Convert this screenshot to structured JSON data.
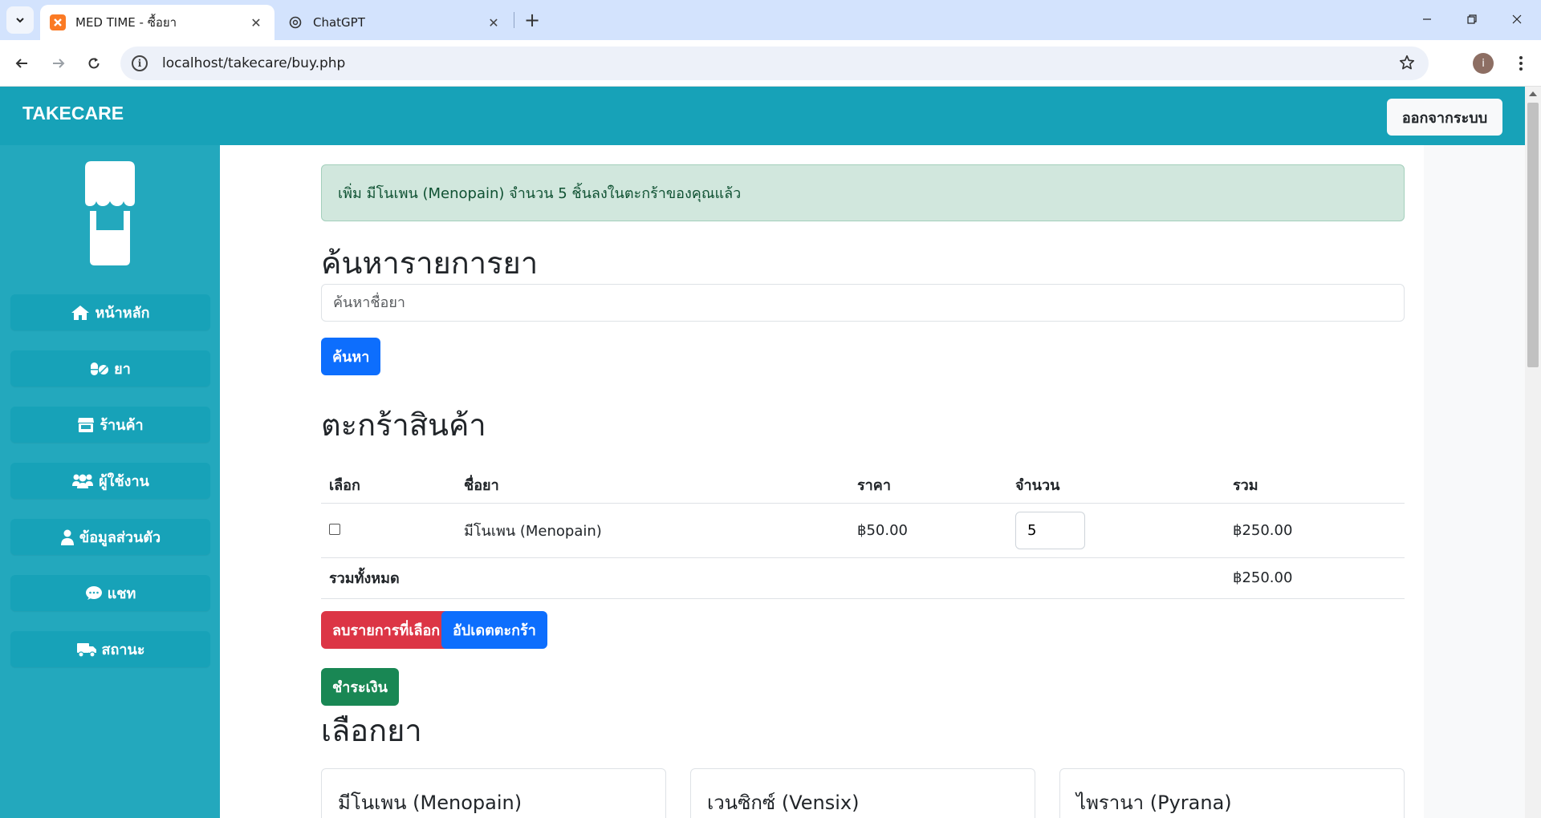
{
  "browser": {
    "tabs": [
      {
        "title": "MED TIME - ซื้อยา",
        "active": true
      },
      {
        "title": "ChatGPT",
        "active": false
      }
    ],
    "url": "localhost/takecare/buy.php",
    "profile_initial": "i"
  },
  "header": {
    "brand": "TAKECARE",
    "logout_label": "ออกจากระบบ",
    "color": "#17a2b8"
  },
  "sidebar": {
    "items": [
      {
        "label": "หน้าหลัก",
        "icon": "home-icon"
      },
      {
        "label": "ยา",
        "icon": "pills-icon"
      },
      {
        "label": "ร้านค้า",
        "icon": "store-icon"
      },
      {
        "label": "ผู้ใช้งาน",
        "icon": "users-icon"
      },
      {
        "label": "ข้อมูลส่วนตัว",
        "icon": "user-icon"
      },
      {
        "label": "แชท",
        "icon": "chat-icon"
      },
      {
        "label": "สถานะ",
        "icon": "truck-icon"
      }
    ]
  },
  "alert": {
    "message": "เพิ่ม มีโนเพน (Menopain) จำนวน 5 ชิ้นลงในตะกร้าของคุณแล้ว"
  },
  "search": {
    "heading": "ค้นหารายการยา",
    "placeholder": "ค้นหาชื่อยา",
    "button_label": "ค้นหา"
  },
  "cart": {
    "heading": "ตะกร้าสินค้า",
    "columns": [
      "เลือก",
      "ชื่อยา",
      "ราคา",
      "จำนวน",
      "รวม"
    ],
    "rows": [
      {
        "name": "มีโนเพน (Menopain)",
        "price": "฿50.00",
        "quantity": "5",
        "total": "฿250.00",
        "selected": false
      }
    ],
    "grand_total_label": "รวมทั้งหมด",
    "grand_total": "฿250.00",
    "delete_button": "ลบรายการที่เลือก",
    "update_button": "อัปเดตตะกร้า",
    "checkout_button": "ชำระเงิน"
  },
  "medicines": {
    "heading": "เลือกยา",
    "items": [
      {
        "name": "มีโนเพน (Menopain)"
      },
      {
        "name": "เวนซิกซ์ (Vensix)"
      },
      {
        "name": "ไพรานา (Pyrana)"
      }
    ]
  }
}
